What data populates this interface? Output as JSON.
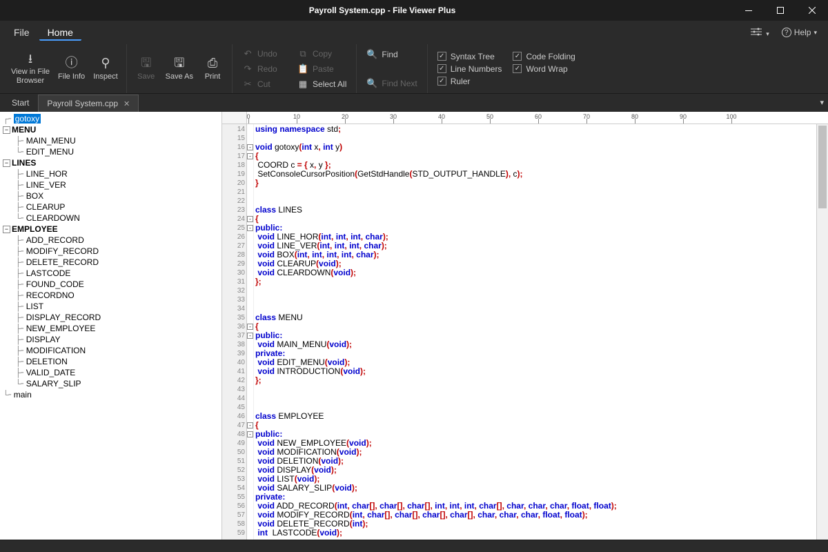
{
  "window": {
    "title": "Payroll System.cpp - File Viewer Plus"
  },
  "menubar": {
    "file": "File",
    "home": "Home",
    "help": "Help"
  },
  "ribbon": {
    "viewInFileBrowser": "View in File\nBrowser",
    "fileInfo": "File Info",
    "inspect": "Inspect",
    "save": "Save",
    "saveAs": "Save As",
    "print": "Print",
    "undo": "Undo",
    "redo": "Redo",
    "cut": "Cut",
    "copy": "Copy",
    "paste": "Paste",
    "selectAll": "Select All",
    "find": "Find",
    "findNext": "Find Next",
    "syntaxTree": "Syntax Tree",
    "lineNumbers": "Line Numbers",
    "ruler": "Ruler",
    "codeFolding": "Code Folding",
    "wordWrap": "Word Wrap"
  },
  "tabs": {
    "start": "Start",
    "file": "Payroll System.cpp"
  },
  "outline": {
    "gotoxy": "gotoxy",
    "menu": "MENU",
    "mainMenu": "MAIN_MENU",
    "editMenu": "EDIT_MENU",
    "lines": "LINES",
    "lineHor": "LINE_HOR",
    "lineVer": "LINE_VER",
    "box": "BOX",
    "clearup": "CLEARUP",
    "cleardown": "CLEARDOWN",
    "employee": "EMPLOYEE",
    "addRecord": "ADD_RECORD",
    "modifyRecord": "MODIFY_RECORD",
    "deleteRecord": "DELETE_RECORD",
    "lastcode": "LASTCODE",
    "foundCode": "FOUND_CODE",
    "recordno": "RECORDNO",
    "list": "LIST",
    "displayRecord": "DISPLAY_RECORD",
    "newEmployee": "NEW_EMPLOYEE",
    "display": "DISPLAY",
    "modification": "MODIFICATION",
    "deletion": "DELETION",
    "validDate": "VALID_DATE",
    "salarySlip": "SALARY_SLIP",
    "main": "main"
  },
  "ruler": {
    "ticks": [
      "0",
      "10",
      "20",
      "30",
      "40",
      "50",
      "60",
      "70",
      "80",
      "90",
      "100"
    ]
  },
  "code": {
    "startLine": 14,
    "lines": [
      {
        "n": 14,
        "h": "<span class='kw'>using namespace</span> std<span class='pn'>;</span>"
      },
      {
        "n": 15,
        "h": ""
      },
      {
        "n": 16,
        "h": "<span class='kw'>void</span> gotoxy<span class='pn'>(</span><span class='kw'>int</span> x<span class='pn'>,</span> <span class='kw'>int</span> y<span class='pn'>)</span>",
        "fold": "-"
      },
      {
        "n": 17,
        "h": "<span class='pn'>{</span>",
        "fold": "-"
      },
      {
        "n": 18,
        "h": " COORD c <span class='pn'>= {</span> x<span class='pn'>,</span> y <span class='pn'>};</span>"
      },
      {
        "n": 19,
        "h": " SetConsoleCursorPosition<span class='pn'>(</span>GetStdHandle<span class='pn'>(</span>STD_OUTPUT_HANDLE<span class='pn'>),</span> c<span class='pn'>);</span>"
      },
      {
        "n": 20,
        "h": "<span class='pn'>}</span>"
      },
      {
        "n": 21,
        "h": ""
      },
      {
        "n": 22,
        "h": ""
      },
      {
        "n": 23,
        "h": "<span class='kw'>class</span> LINES"
      },
      {
        "n": 24,
        "h": "<span class='pn'>{</span>",
        "fold": "-"
      },
      {
        "n": 25,
        "h": "<span class='kw'>public:</span>",
        "fold": "-"
      },
      {
        "n": 26,
        "h": " <span class='kw'>void</span> LINE_HOR<span class='pn'>(</span><span class='kw'>int</span><span class='pn'>,</span> <span class='kw'>int</span><span class='pn'>,</span> <span class='kw'>int</span><span class='pn'>,</span> <span class='kw'>char</span><span class='pn'>);</span>"
      },
      {
        "n": 27,
        "h": " <span class='kw'>void</span> LINE_VER<span class='pn'>(</span><span class='kw'>int</span><span class='pn'>,</span> <span class='kw'>int</span><span class='pn'>,</span> <span class='kw'>int</span><span class='pn'>,</span> <span class='kw'>char</span><span class='pn'>);</span>"
      },
      {
        "n": 28,
        "h": " <span class='kw'>void</span> BOX<span class='pn'>(</span><span class='kw'>int</span><span class='pn'>,</span> <span class='kw'>int</span><span class='pn'>,</span> <span class='kw'>int</span><span class='pn'>,</span> <span class='kw'>int</span><span class='pn'>,</span> <span class='kw'>char</span><span class='pn'>);</span>"
      },
      {
        "n": 29,
        "h": " <span class='kw'>void</span> CLEARUP<span class='pn'>(</span><span class='kw'>void</span><span class='pn'>);</span>"
      },
      {
        "n": 30,
        "h": " <span class='kw'>void</span> CLEARDOWN<span class='pn'>(</span><span class='kw'>void</span><span class='pn'>);</span>"
      },
      {
        "n": 31,
        "h": "<span class='pn'>};</span>"
      },
      {
        "n": 32,
        "h": ""
      },
      {
        "n": 33,
        "h": ""
      },
      {
        "n": 34,
        "h": ""
      },
      {
        "n": 35,
        "h": "<span class='kw'>class</span> MENU"
      },
      {
        "n": 36,
        "h": "<span class='pn'>{</span>",
        "fold": "-"
      },
      {
        "n": 37,
        "h": "<span class='kw'>public:</span>",
        "fold": "-"
      },
      {
        "n": 38,
        "h": " <span class='kw'>void</span> MAIN_MENU<span class='pn'>(</span><span class='kw'>void</span><span class='pn'>);</span>"
      },
      {
        "n": 39,
        "h": "<span class='kw'>private:</span>"
      },
      {
        "n": 40,
        "h": " <span class='kw'>void</span> EDIT_MENU<span class='pn'>(</span><span class='kw'>void</span><span class='pn'>);</span>"
      },
      {
        "n": 41,
        "h": " <span class='kw'>void</span> INTRODUCTION<span class='pn'>(</span><span class='kw'>void</span><span class='pn'>);</span>"
      },
      {
        "n": 42,
        "h": "<span class='pn'>};</span>"
      },
      {
        "n": 43,
        "h": ""
      },
      {
        "n": 44,
        "h": ""
      },
      {
        "n": 45,
        "h": ""
      },
      {
        "n": 46,
        "h": "<span class='kw'>class</span> EMPLOYEE"
      },
      {
        "n": 47,
        "h": "<span class='pn'>{</span>",
        "fold": "-"
      },
      {
        "n": 48,
        "h": "<span class='kw'>public:</span>",
        "fold": "-"
      },
      {
        "n": 49,
        "h": " <span class='kw'>void</span> NEW_EMPLOYEE<span class='pn'>(</span><span class='kw'>void</span><span class='pn'>);</span>"
      },
      {
        "n": 50,
        "h": " <span class='kw'>void</span> MODIFICATION<span class='pn'>(</span><span class='kw'>void</span><span class='pn'>);</span>"
      },
      {
        "n": 51,
        "h": " <span class='kw'>void</span> DELETION<span class='pn'>(</span><span class='kw'>void</span><span class='pn'>);</span>"
      },
      {
        "n": 52,
        "h": " <span class='kw'>void</span> DISPLAY<span class='pn'>(</span><span class='kw'>void</span><span class='pn'>);</span>"
      },
      {
        "n": 53,
        "h": " <span class='kw'>void</span> LIST<span class='pn'>(</span><span class='kw'>void</span><span class='pn'>);</span>"
      },
      {
        "n": 54,
        "h": " <span class='kw'>void</span> SALARY_SLIP<span class='pn'>(</span><span class='kw'>void</span><span class='pn'>);</span>"
      },
      {
        "n": 55,
        "h": "<span class='kw'>private:</span>"
      },
      {
        "n": 56,
        "h": " <span class='kw'>void</span> ADD_RECORD<span class='pn'>(</span><span class='kw'>int</span><span class='pn'>,</span> <span class='kw'>char</span><span class='pn'>[],</span> <span class='kw'>char</span><span class='pn'>[],</span> <span class='kw'>char</span><span class='pn'>[],</span> <span class='kw'>int</span><span class='pn'>,</span> <span class='kw'>int</span><span class='pn'>,</span> <span class='kw'>int</span><span class='pn'>,</span> <span class='kw'>char</span><span class='pn'>[],</span> <span class='kw'>char</span><span class='pn'>,</span> <span class='kw'>char</span><span class='pn'>,</span> <span class='kw'>char</span><span class='pn'>,</span> <span class='kw'>float</span><span class='pn'>,</span> <span class='kw'>float</span><span class='pn'>);</span>"
      },
      {
        "n": 57,
        "h": " <span class='kw'>void</span> MODIFY_RECORD<span class='pn'>(</span><span class='kw'>int</span><span class='pn'>,</span> <span class='kw'>char</span><span class='pn'>[],</span> <span class='kw'>char</span><span class='pn'>[],</span> <span class='kw'>char</span><span class='pn'>[],</span> <span class='kw'>char</span><span class='pn'>[],</span> <span class='kw'>char</span><span class='pn'>,</span> <span class='kw'>char</span><span class='pn'>,</span> <span class='kw'>char</span><span class='pn'>,</span> <span class='kw'>float</span><span class='pn'>,</span> <span class='kw'>float</span><span class='pn'>);</span>"
      },
      {
        "n": 58,
        "h": " <span class='kw'>void</span> DELETE_RECORD<span class='pn'>(</span><span class='kw'>int</span><span class='pn'>);</span>"
      },
      {
        "n": 59,
        "h": " <span class='kw'>int</span>  LASTCODE<span class='pn'>(</span><span class='kw'>void</span><span class='pn'>);</span>"
      }
    ]
  }
}
